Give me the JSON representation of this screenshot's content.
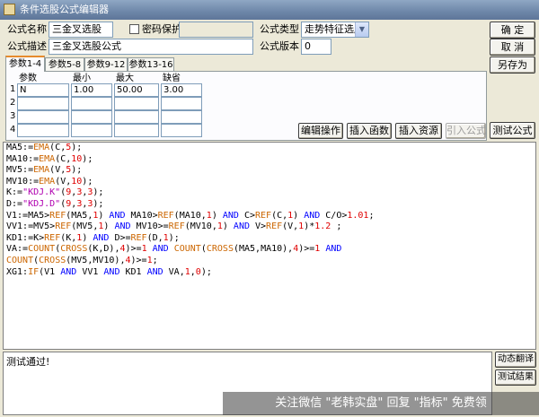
{
  "window": {
    "title": "条件选股公式编辑器"
  },
  "form": {
    "name_label": "公式名称",
    "name_value": "三金叉选股",
    "password_label": "密码保护",
    "password_value": "",
    "type_label": "公式类型",
    "type_value": "走势特征选股",
    "desc_label": "公式描述",
    "desc_value": "三金叉选股公式",
    "version_label": "公式版本",
    "version_value": "0"
  },
  "buttons": {
    "ok": "确  定",
    "cancel": "取  消",
    "save_as": "另存为",
    "edit_ops": "编辑操作",
    "insert_func": "插入函数",
    "insert_resource": "插入资源",
    "import_formula": "引入公式",
    "test_formula": "测试公式",
    "dynamic_translate": "动态翻译",
    "test_result": "测试结果"
  },
  "tabs": [
    "参数1-4",
    "参数5-8",
    "参数9-12",
    "参数13-16"
  ],
  "params": {
    "headers": [
      "参数",
      "最小",
      "最大",
      "缺省"
    ],
    "rows": [
      {
        "num": "1",
        "name": "N",
        "min": "1.00",
        "max": "50.00",
        "default": "3.00"
      },
      {
        "num": "2",
        "name": "",
        "min": "",
        "max": "",
        "default": ""
      },
      {
        "num": "3",
        "name": "",
        "min": "",
        "max": "",
        "default": ""
      },
      {
        "num": "4",
        "name": "",
        "min": "",
        "max": "",
        "default": ""
      }
    ]
  },
  "code": [
    "MA5:=EMA(C,5);",
    "MA10:=EMA(C,10);",
    "MV5:=EMA(V,5);",
    "MV10:=EMA(V,10);",
    "K:=\"KDJ.K\"(9,3,3);",
    "D:=\"KDJ.D\"(9,3,3);",
    "V1:=MA5>REF(MA5,1) AND MA10>REF(MA10,1) AND C>REF(C,1) AND C/O>1.01;",
    "VV1:=MV5>REF(MV5,1) AND MV10>=REF(MV10,1) AND V>REF(V,1)*1.2 ;",
    "KD1:=K>REF(K,1) AND D>=REF(D,1);",
    "VA:=COUNT(CROSS(K,D),4)>=1 AND COUNT(CROSS(MA5,MA10),4)>=1 AND",
    "COUNT(CROSS(MV5,MV10),4)>=1;",
    "XG1:IF(V1 AND VV1 AND KD1 AND VA,1,0);"
  ],
  "output_text": "测试通过!",
  "watermark": "关注微信 \"老韩实盘\" 回复 \"指标\" 免费领"
}
